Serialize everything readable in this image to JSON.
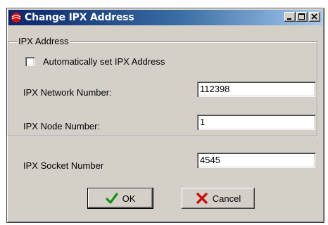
{
  "window": {
    "title": "Change IPX Address",
    "icon": "red-ball-icon",
    "controls": [
      "minimize",
      "maximize",
      "close"
    ]
  },
  "group": {
    "legend": "IPX Address",
    "auto_checkbox_label": "Automatically set IPX Address",
    "auto_checked": false
  },
  "fields": {
    "network_label": "IPX Network Number:",
    "network_value": "112398",
    "node_label": "IPX Node Number:",
    "node_value": "1",
    "socket_label": "IPX Socket Number",
    "socket_value": "4545"
  },
  "buttons": {
    "ok_label": "OK",
    "cancel_label": "Cancel",
    "ok_icon": "green-check-icon",
    "cancel_icon": "red-x-icon"
  },
  "colors": {
    "titlebar_start": "#0a246a",
    "titlebar_end": "#a6caf0",
    "window_bg": "#d4d0c8"
  }
}
